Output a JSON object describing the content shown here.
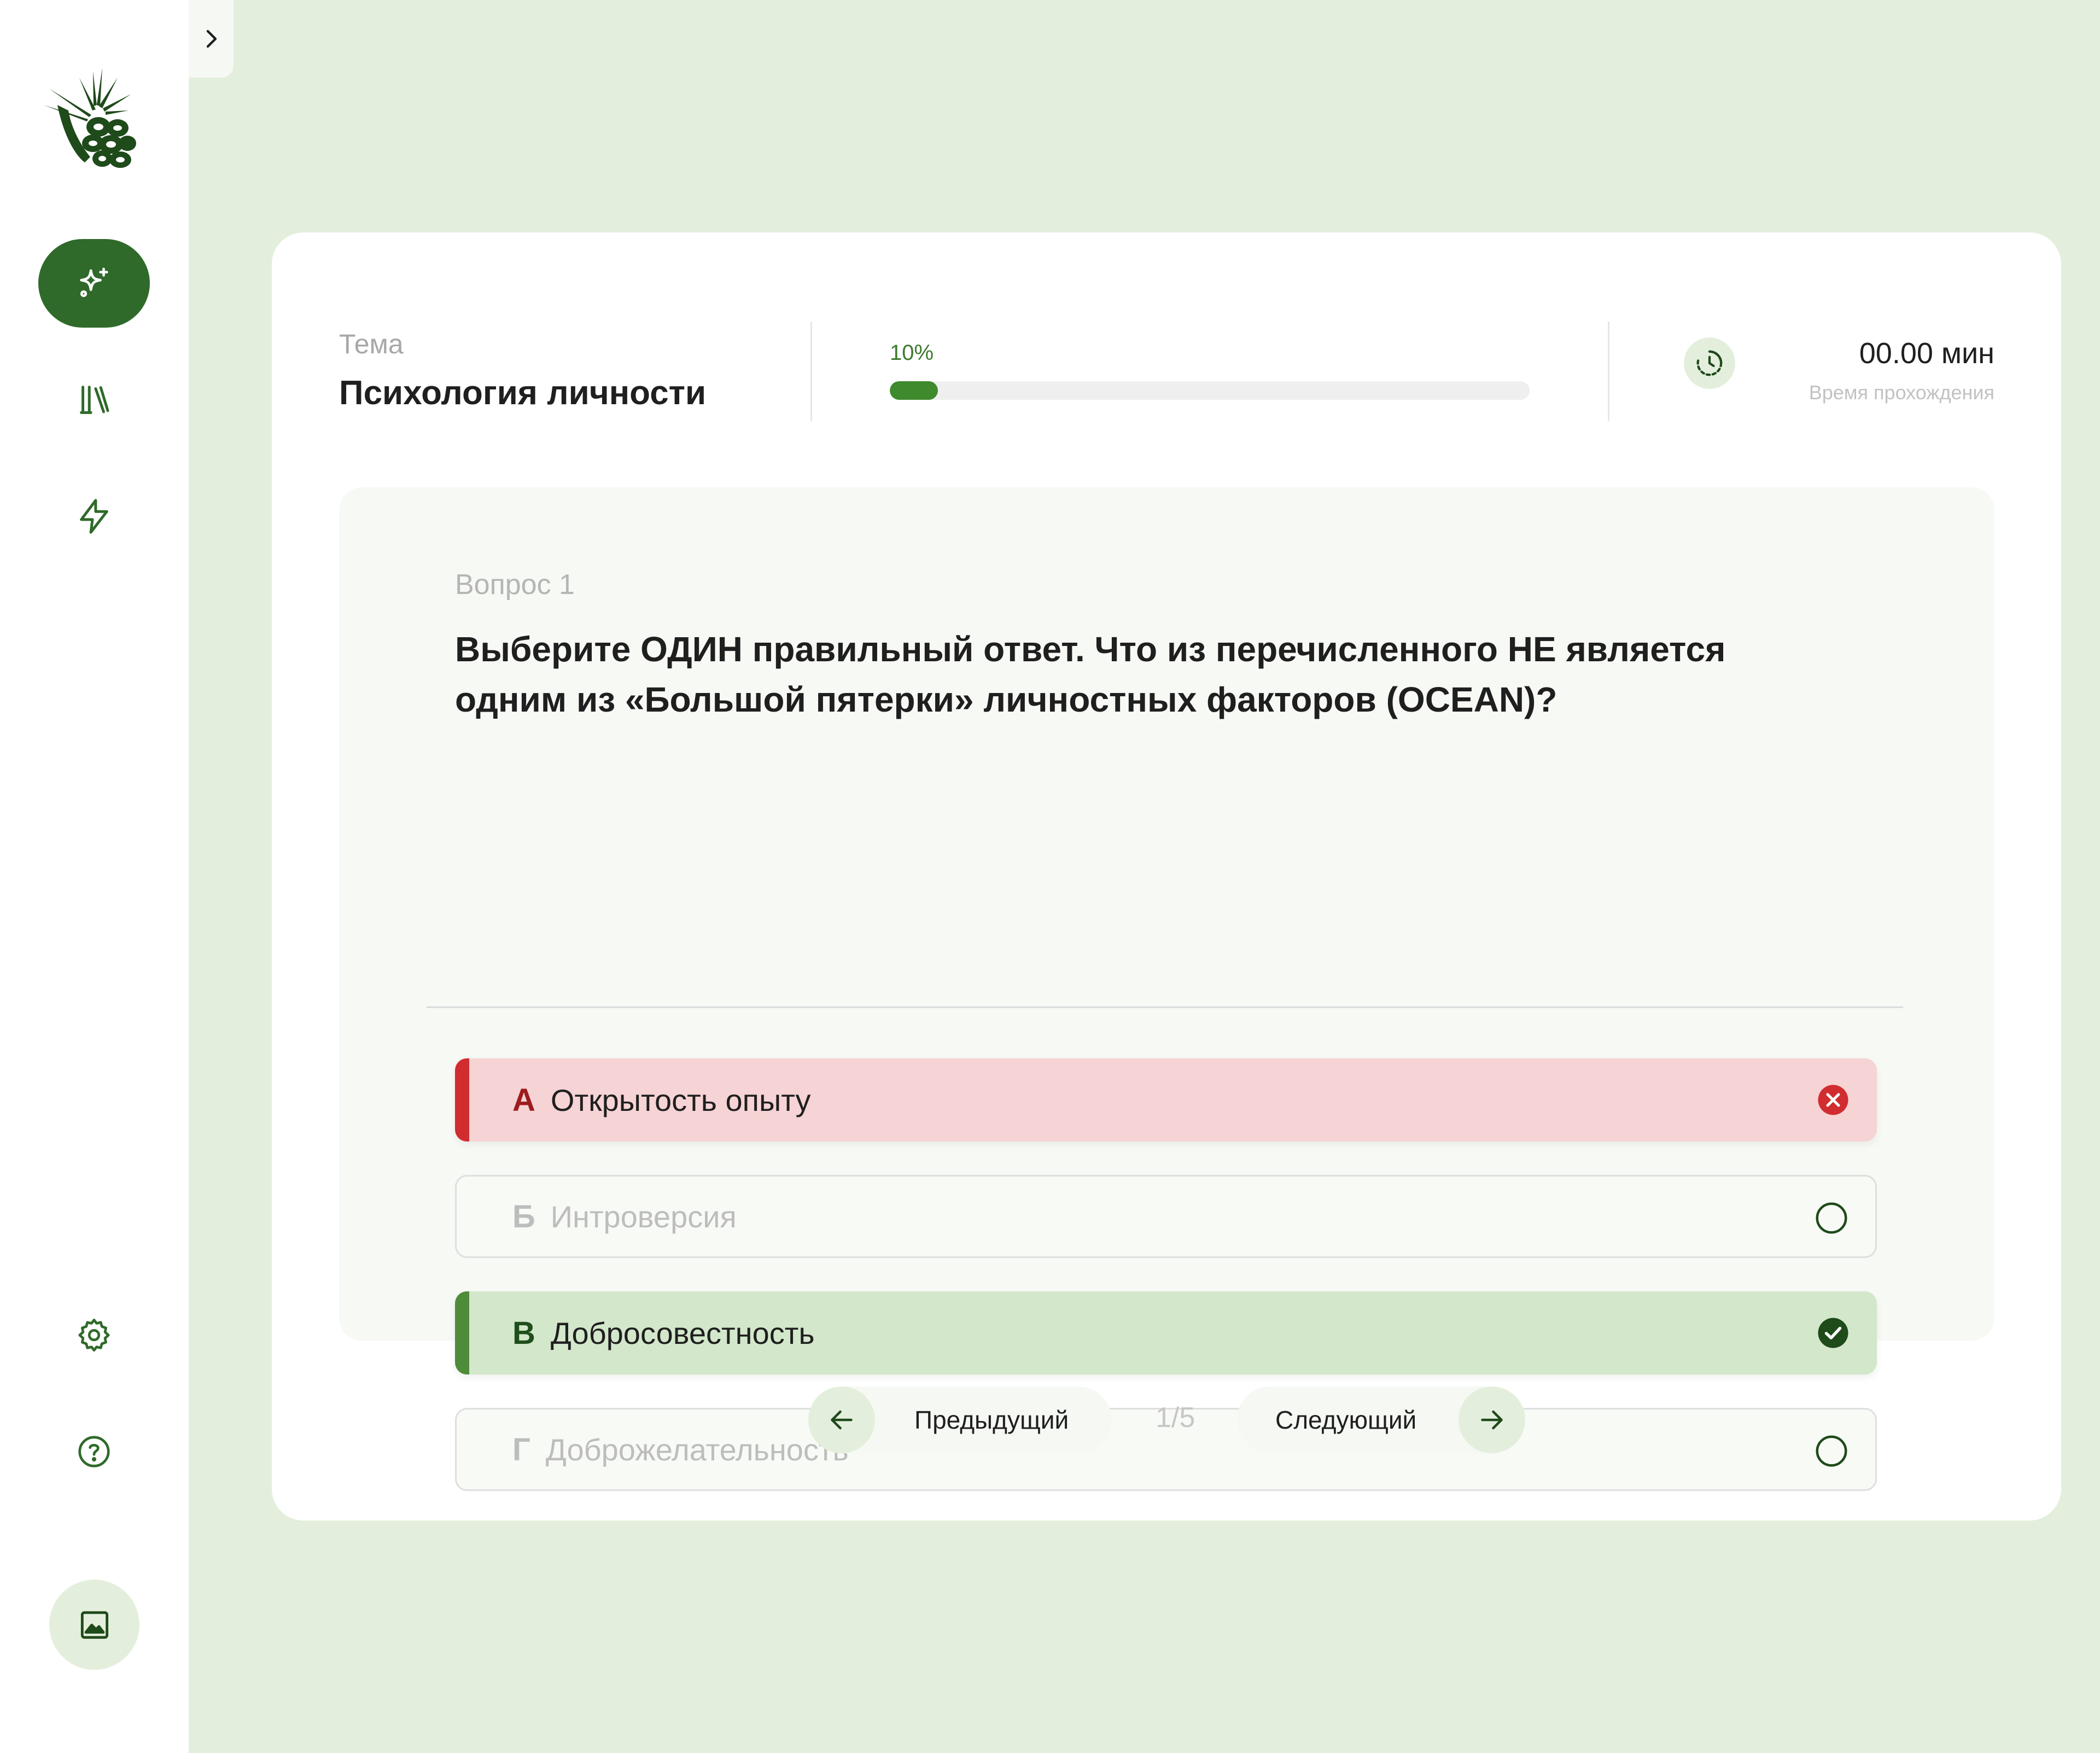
{
  "sidebar": {
    "logo": "pine-cone-logo",
    "expand_icon": "chevron-right-icon",
    "nav": [
      {
        "icon": "sparkles-icon",
        "active": true
      },
      {
        "icon": "library-icon",
        "active": false
      },
      {
        "icon": "lightning-icon",
        "active": false
      }
    ],
    "bottom": [
      {
        "icon": "gear-icon"
      },
      {
        "icon": "help-circle-icon"
      }
    ],
    "image_button_icon": "image-icon"
  },
  "header": {
    "topic_label": "Тема",
    "topic_title": "Психология личности",
    "progress_label": "10%",
    "progress_value": 0.075,
    "time_value": "00.00 мин",
    "time_label": "Время прохождения",
    "clock_icon": "clock-history-icon"
  },
  "question": {
    "number_label": "Вопрос 1",
    "text": "Выберите ОДИН правильный ответ. Что из перечисленного НЕ является одним из «Большой пятерки» личностных факторов (OCEAN)?",
    "options": [
      {
        "letter": "А",
        "label": "Открытость опыту",
        "state": "wrong",
        "icon": "x-circle-icon"
      },
      {
        "letter": "Б",
        "label": "Интроверсия",
        "state": "neutral",
        "icon": "empty-circle-icon"
      },
      {
        "letter": "В",
        "label": "Добросовестность",
        "state": "correct",
        "icon": "check-circle-icon"
      },
      {
        "letter": "Г",
        "label": "Доброжелательность",
        "state": "neutral",
        "icon": "empty-circle-icon"
      }
    ]
  },
  "navigation": {
    "prev_label": "Предыдущий",
    "next_label": "Следующий",
    "page": "1/5"
  },
  "colors": {
    "background": "#e3efdc",
    "accent": "#2f6a2a",
    "wrong": "#d12c2f",
    "correct": "#4f8c3a"
  }
}
